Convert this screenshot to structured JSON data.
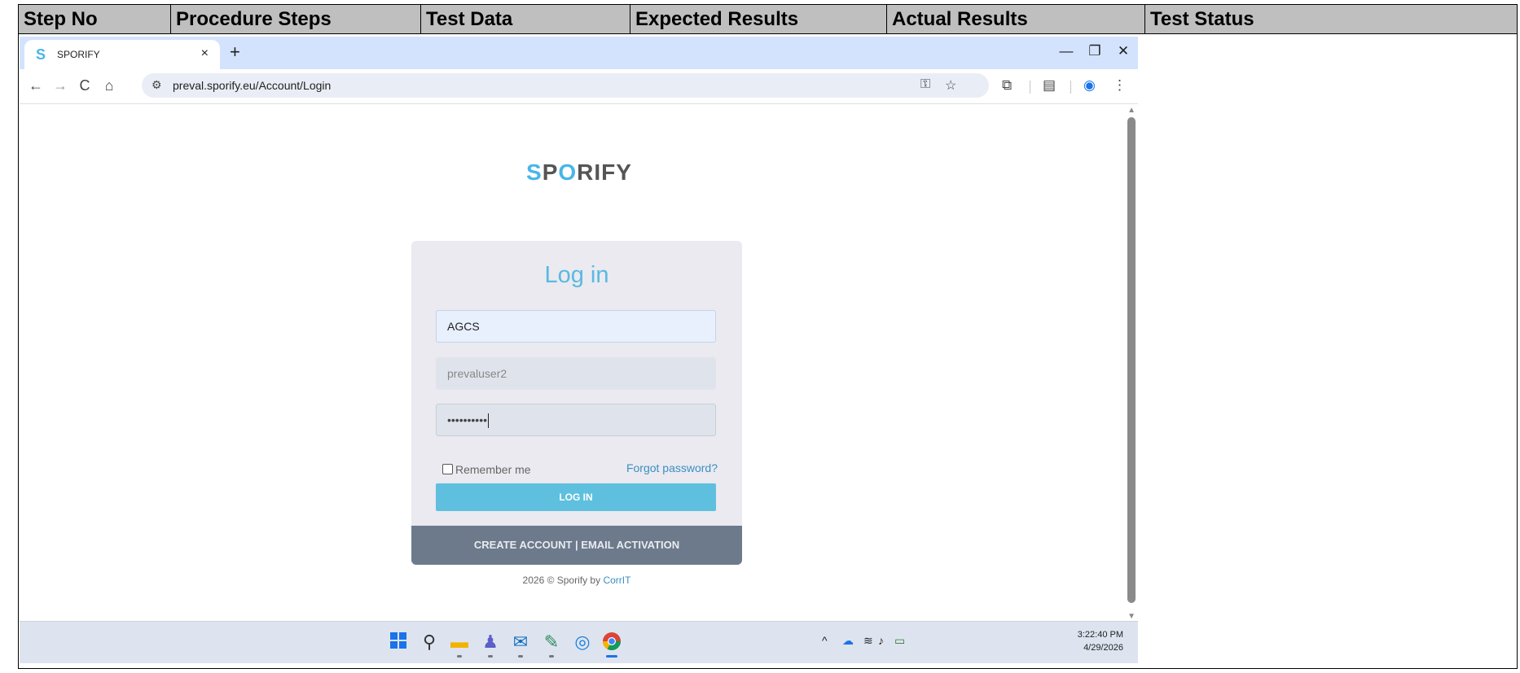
{
  "doc_table": {
    "columns": [
      "Step No",
      "Procedure Steps",
      "Test Data",
      "Expected Results",
      "Actual Results",
      "Test Status"
    ]
  },
  "browser": {
    "tab_title": "SPORIFY",
    "tab_close": "×",
    "new_tab": "+",
    "window_controls": {
      "minimize": "—",
      "restore": "❐",
      "close": "✕"
    },
    "nav": {
      "back": "←",
      "forward": "→",
      "reload": "C",
      "home": "⌂"
    },
    "url": "preval.sporify.eu/Account/Login",
    "omnibox_icons": [
      "password-key-icon",
      "bookmark-star-icon"
    ],
    "toolbar_icons": [
      "extensions-icon",
      "reading-mode-icon",
      "profile-icon",
      "menu-icon"
    ]
  },
  "login_page": {
    "logo": {
      "s": "S",
      "p": "P",
      "o": "O",
      "rest": "RIFY"
    },
    "title": "Log in",
    "tenant_value": "AGCS",
    "username_value": "prevaluser2",
    "password_mask": "••••••••••",
    "remember_label": "Remember me",
    "forgot_link": "Forgot password?",
    "login_button": "LOG IN",
    "footer_links": "CREATE ACCOUNT | EMAIL ACTIVATION",
    "copyright": "2026 © Sporify by ",
    "copyright_link": "CorrIT"
  },
  "taskbar": {
    "apps": [
      "windows-start-icon",
      "search-icon",
      "file-explorer-icon",
      "teams-icon",
      "outlook-icon",
      "notepad-icon",
      "edge-icon",
      "chrome-icon"
    ],
    "tray_icons": [
      "chevron-up-icon",
      "onedrive-icon",
      "wifi-icon",
      "volume-icon",
      "battery-icon"
    ],
    "time": "3:22:40 PM",
    "date": "4/29/2026"
  },
  "colors": {
    "accent": "#5ec0de",
    "logo_blue": "#47b6e8",
    "footer_bar": "#6d7a8c",
    "header_gray": "#bfbfbf"
  }
}
